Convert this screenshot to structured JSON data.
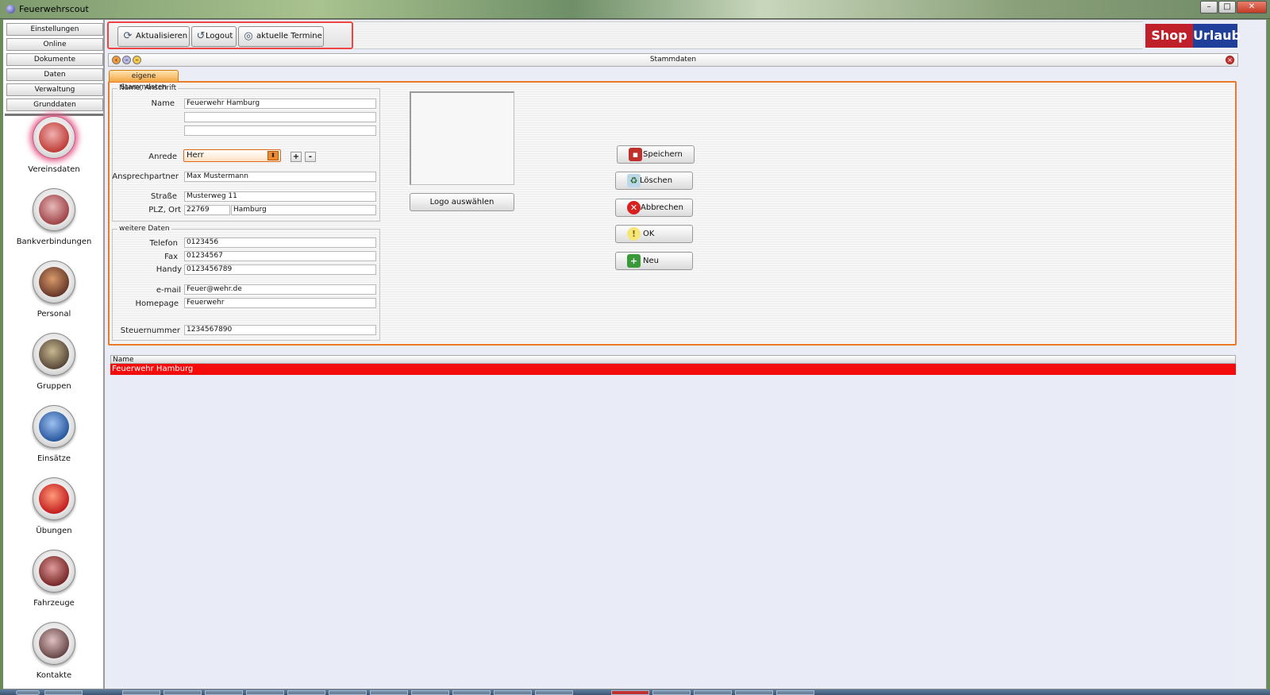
{
  "window": {
    "title": "Feuerwehrscout",
    "btn_minimize": "–",
    "btn_maximize": "□",
    "btn_close": "✕"
  },
  "sidebar": {
    "menu": [
      {
        "label": "Einstellungen"
      },
      {
        "label": "Online"
      },
      {
        "label": "Dokumente"
      },
      {
        "label": "Daten"
      },
      {
        "label": "Verwaltung"
      },
      {
        "label": "Grunddaten"
      }
    ],
    "nav": [
      {
        "label": "Vereinsdaten",
        "icon": "crown-icon",
        "color": "#c0403a"
      },
      {
        "label": "Bankverbindungen",
        "icon": "piggy-bank-icon",
        "color": "#a0464a"
      },
      {
        "label": "Personal",
        "icon": "firefighter-icon",
        "color": "#6a3a2a"
      },
      {
        "label": "Gruppen",
        "icon": "group-icon",
        "color": "#5a4a3a"
      },
      {
        "label": "Einsätze",
        "icon": "deployment-sign-icon",
        "color": "#2a5aa0"
      },
      {
        "label": "Übungen",
        "icon": "siren-icon",
        "color": "#c42020"
      },
      {
        "label": "Fahrzeuge",
        "icon": "fire-truck-icon",
        "color": "#7a2a2a"
      },
      {
        "label": "Kontakte",
        "icon": "contact-person-icon",
        "color": "#6a4a4a"
      }
    ]
  },
  "toolbar": {
    "refresh_label": "Aktualisieren",
    "logout_label": "Logout",
    "appointments_label": "aktuelle Termine"
  },
  "logo": {
    "part1": "Shop",
    "part2": "Urlaub",
    "color1": "#c0202a",
    "color2": "#1f3f9a"
  },
  "inner_window": {
    "title": "Stammdaten"
  },
  "tab": {
    "label": "eigene Stammdaten"
  },
  "form": {
    "section1": {
      "legend": "Name, Anschrift",
      "name_label": "Name",
      "name_value": "Feuerwehr Hamburg",
      "name2_value": "",
      "name3_value": "",
      "salutation_label": "Anrede",
      "salutation_value": "Herr",
      "contact_label": "Ansprechpartner",
      "contact_value": "Max Mustermann",
      "street_label": "Straße",
      "street_value": "Musterweg 11",
      "zipcity_label": "PLZ, Ort",
      "zip_value": "22769",
      "city_value": "Hamburg"
    },
    "section2": {
      "legend": "weitere Daten",
      "phone_label": "Telefon",
      "phone_value": "0123456",
      "fax_label": "Fax",
      "fax_value": "01234567",
      "mobile_label": "Handy",
      "mobile_value": "0123456789",
      "email_label": "e-mail",
      "email_value": "Feuer@wehr.de",
      "homepage_label": "Homepage",
      "homepage_value": "Feuerwehr",
      "taxno_label": "Steuernummer",
      "taxno_value": "1234567890"
    },
    "plus_label": "+",
    "minus_label": "-",
    "logo_button": "Logo auswählen"
  },
  "actions": {
    "save": "Speichern",
    "delete": "Löschen",
    "cancel": "Abbrechen",
    "ok": "OK",
    "new": "Neu"
  },
  "list": {
    "header": "Name",
    "rows": [
      {
        "name": "Feuerwehr Hamburg"
      }
    ],
    "selected_color": "#f40c0c"
  }
}
